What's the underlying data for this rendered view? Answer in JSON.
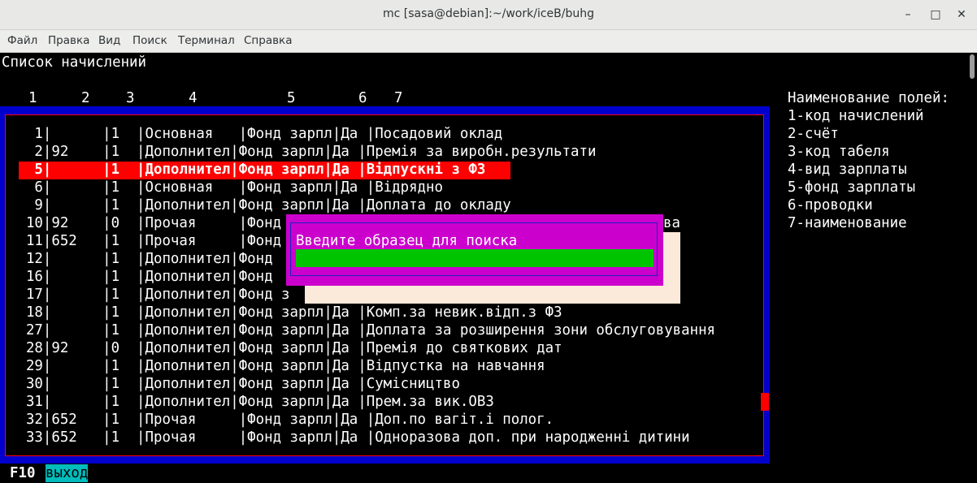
{
  "window": {
    "title": "mc [sasa@debian]:~/work/iceB/buhg",
    "minimize": "–",
    "maximize": "□",
    "close": "✕"
  },
  "menu": [
    "Файл",
    "Правка",
    "Вид",
    "Поиск",
    "Терминал",
    "Справка"
  ],
  "screen_title": "Список начислений",
  "column_numbers": [
    "1",
    "2",
    "3",
    "4",
    "5",
    "6",
    "7"
  ],
  "rows": [
    "   1|      |1  |Основная   |Фонд зарпл|Да |Посадовий оклад",
    "   2|92    |1  |Дополнител|Фонд зарпл|Да |Премія за виробн.результати",
    "   5|      |1  |Дополнител|Фонд зарпл|Да |Відпускні з ФЗ",
    "   6|      |1  |Основная   |Фонд зарпл|Да |Відрядно",
    "   9|      |1  |Дополнител|Фонд зарпл|Да |Доплата до окладу",
    "  10|92    |0  |Прочая     |Фонд",
    "  11|652   |1  |Прочая     |Фонд",
    "  12|      |1  |Дополнител|Фонд",
    "  16|      |1  |Дополнител|Фонд",
    "  17|      |1  |Дополнител|Фонд з",
    "  18|      |1  |Дополнител|Фонд зарпл|Да |Комп.за невик.відп.з ФЗ",
    "  27|      |1  |Дополнител|Фонд зарпл|Да |Доплата за розширення зони обслуговування",
    "  28|92    |0  |Дополнител|Фонд зарпл|Да |Премія до святкових дат",
    "  29|      |1  |Дополнител|Фонд зарпл|Да |Відпустка на навчання",
    "  30|      |1  |Дополнител|Фонд зарпл|Да |Сумісництво",
    "  31|      |1  |Дополнител|Фонд зарпл|Да |Прем.за вик.ОВЗ",
    "  32|652   |1  |Прочая     |Фонд зарпл|Да |Доп.по вагіт.і полог.",
    "  33|652   |1  |Прочая     |Фонд зарпл|Да |Одноразова доп. при народженні дитини"
  ],
  "row10_tail": "ва",
  "selected_row_index": 2,
  "legend": [
    "Наименование полей:",
    "1-код начислений",
    "2-счёт",
    "3-код табеля",
    "4-вид зарплаты",
    "5-фонд зарплаты",
    "6-проводки",
    "7-наименование"
  ],
  "dialog": {
    "prompt": "Введите образец для поиска",
    "value": ""
  },
  "footer": {
    "key": "F10",
    "label": "выход"
  },
  "colors": {
    "frame": "#0000cd",
    "selection": "#ff0000",
    "dialog": "#cc00cc",
    "input": "#00c400",
    "exit_bg": "#00bcbc"
  }
}
